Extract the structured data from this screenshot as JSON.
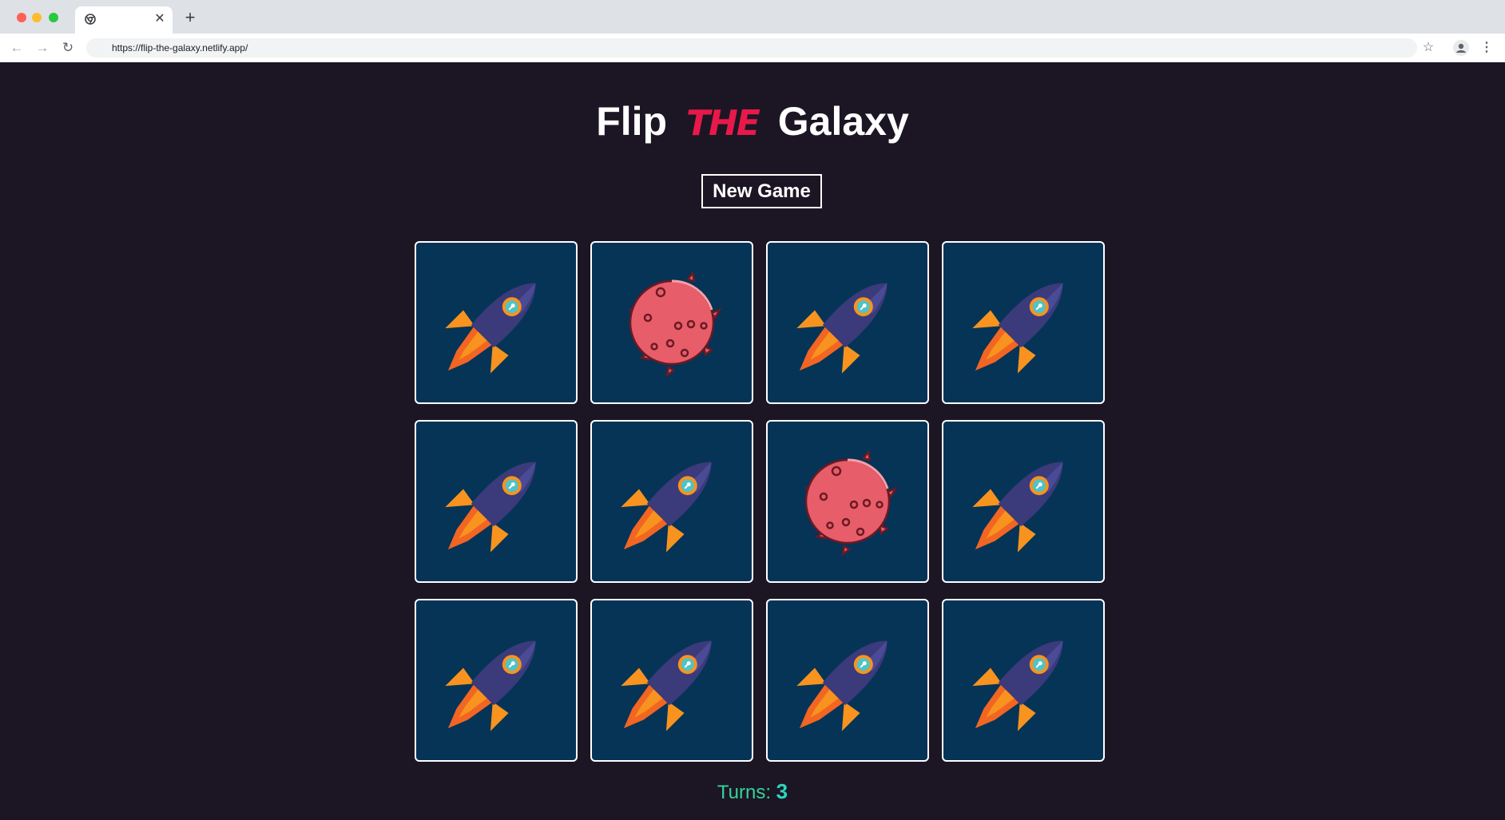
{
  "browser": {
    "url": "https://flip-the-galaxy.netlify.app/"
  },
  "game": {
    "title_part1": "Flip",
    "title_part2": "THE",
    "title_part3": "Galaxy",
    "new_game_label": "New Game",
    "turns_label": "Turns:",
    "turns_value": "3",
    "cards": [
      {
        "face": "rocket-icon"
      },
      {
        "face": "meteor-icon"
      },
      {
        "face": "rocket-icon"
      },
      {
        "face": "rocket-icon"
      },
      {
        "face": "rocket-icon"
      },
      {
        "face": "rocket-icon"
      },
      {
        "face": "meteor-icon"
      },
      {
        "face": "rocket-icon"
      },
      {
        "face": "rocket-icon"
      },
      {
        "face": "rocket-icon"
      },
      {
        "face": "rocket-icon"
      },
      {
        "face": "rocket-icon"
      }
    ]
  },
  "colors": {
    "page_bg": "#1c1624",
    "card_bg": "#053457",
    "accent_red": "#e8194a",
    "turns_green": "#34d399"
  }
}
